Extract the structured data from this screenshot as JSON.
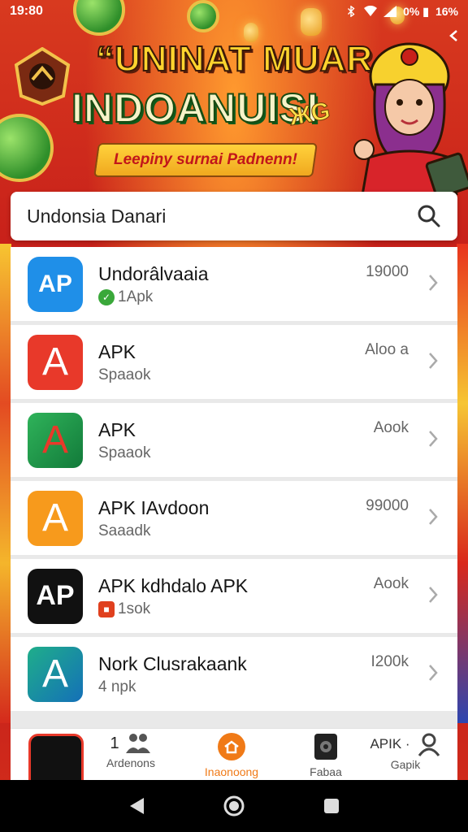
{
  "status_bar": {
    "time": "19:80",
    "battery_text": "0% ▮",
    "battery_pct": "16%"
  },
  "hero": {
    "title_line1": "“UNINAT MUAR",
    "title_line2": "INDOANUISI",
    "ribbon": "Leepiny surnai Padnenn!",
    "sparkle": "ЖG"
  },
  "search": {
    "value": "Undonsia Danari"
  },
  "apps": [
    {
      "name": "Undorâlvaaia",
      "sub": "1Apk",
      "count": "19000",
      "icon_text": "AP",
      "icon_color": "#1f8fe8",
      "badge_color": "#3aa83a",
      "badge": "✓"
    },
    {
      "name": "APK",
      "sub": "Spaaok",
      "count": "Aloo a",
      "icon_text": "A",
      "icon_color": "#e8392a",
      "badge_color": "",
      "badge": ""
    },
    {
      "name": "APK",
      "sub": "Spaaok",
      "count": "Aook",
      "icon_text": "A",
      "icon_color": "#22a04b",
      "badge_color": "",
      "badge": ""
    },
    {
      "name": "APK IAvdoon",
      "sub": "Saaadk",
      "count": "99000",
      "icon_text": "A",
      "icon_color": "#f79a1c",
      "badge_color": "",
      "badge": ""
    },
    {
      "name": "APK kdhdalo  APK",
      "sub": "1sok",
      "count": "Aook",
      "icon_text": "AP",
      "icon_color": "#111111",
      "badge_color": "#e0401e",
      "badge": "■"
    },
    {
      "name": "Nork Clusrakaank",
      "sub": "4 npk",
      "count": "I200k",
      "icon_text": "A",
      "icon_color": "#1ba69a",
      "badge_color": "",
      "badge": ""
    }
  ],
  "bottom_nav": {
    "left_num": "1",
    "items": [
      {
        "label": "Ardenons"
      },
      {
        "label": "Inaonoong"
      },
      {
        "label": "Fabaa"
      },
      {
        "label": "Gapik",
        "top": "APIK ·"
      }
    ]
  },
  "colors": {
    "accent": "#f07a17",
    "hero_yellow": "#ffd42e",
    "banner_red": "#c8201a"
  },
  "icons": {
    "search": "search-icon",
    "chevron": "chevron-right-icon",
    "back": "chevron-left-icon"
  }
}
